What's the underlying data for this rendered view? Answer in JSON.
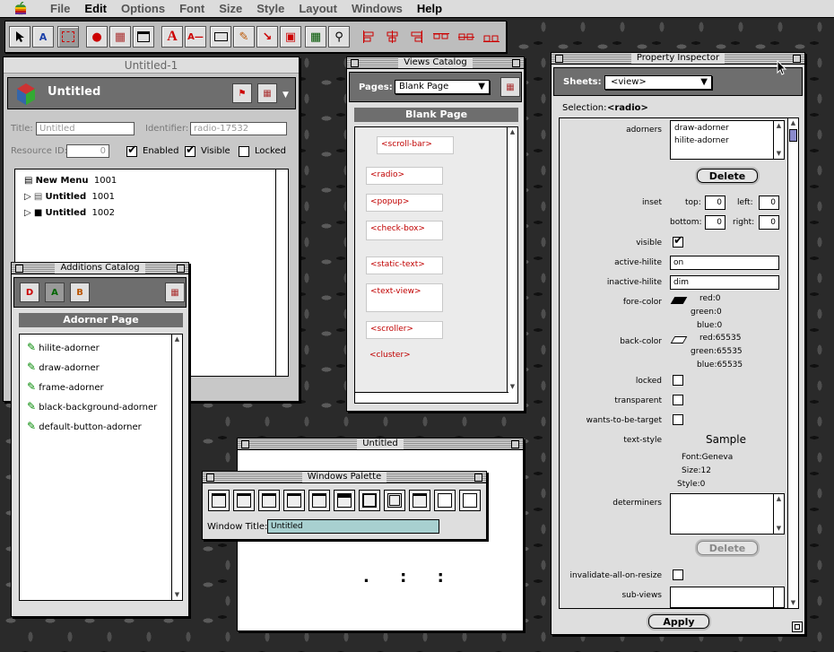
{
  "menubar": {
    "items": [
      "File",
      "Edit",
      "Options",
      "Font",
      "Size",
      "Style",
      "Layout",
      "Windows",
      "Help"
    ],
    "active": [
      "Edit",
      "Help"
    ]
  },
  "toolbar": {
    "tools": [
      "arrow-tool",
      "text-arrow-tool",
      "marquee-tool",
      "adorner-tool",
      "stack-tool",
      "window-tool",
      "text-tool",
      "static-text-tool",
      "edit-text-tool",
      "property-tool",
      "link-tool",
      "cluster-tool",
      "grid-tool",
      "zoom-tool",
      "align-left-tool",
      "align-center-tool",
      "align-right-tool",
      "distribute-h-tool",
      "distribute-v-tool",
      "distribute-bottom-tool"
    ],
    "tool_glyphs": {
      "text-tool": "A"
    }
  },
  "untitled1": {
    "title": "Untitled-1",
    "header": "Untitled",
    "title_label": "Title:",
    "title_value": "Untitled",
    "identifier_label": "Identifier:",
    "identifier_value": "radio-17532",
    "resource_label": "Resource ID:",
    "resource_value": "0",
    "enabled": "Enabled",
    "visible": "Visible",
    "locked": "Locked",
    "tree": [
      {
        "name": "New Menu",
        "id": "1001"
      },
      {
        "name": "Untitled",
        "id": "1001"
      },
      {
        "name": "Untitled",
        "id": "1002"
      }
    ]
  },
  "views_catalog": {
    "title": "Views Catalog",
    "pages_label": "Pages:",
    "pages_value": "Blank Page",
    "page_header": "Blank Page",
    "items": [
      "<scroll-bar>",
      "<radio>",
      "<popup>",
      "<check-box>",
      "<static-text>",
      "<text-view>",
      "<scroller>",
      "<cluster>"
    ]
  },
  "additions": {
    "title": "Additions Catalog",
    "page_header": "Adorner Page",
    "items": [
      "hilite-adorner",
      "draw-adorner",
      "frame-adorner",
      "black-background-adorner",
      "default-button-adorner"
    ]
  },
  "untitled_win": {
    "title": "Untitled",
    "dots": ". : :"
  },
  "windows_palette": {
    "title": "Windows Palette",
    "window_title_label": "Window Title:",
    "window_title_value": "Untitled"
  },
  "inspector": {
    "title": "Property Inspector",
    "sheets_label": "Sheets:",
    "sheets_value": "<view>",
    "selection_label": "Selection:",
    "selection_value": "<radio>",
    "adorners_label": "adorners",
    "adorners": [
      "draw-adorner",
      "hilite-adorner"
    ],
    "delete": "Delete",
    "inset_label": "inset",
    "top": "top:",
    "left": "left:",
    "bottom": "bottom:",
    "right": "right:",
    "inset_top": "0",
    "inset_left": "0",
    "inset_bottom": "0",
    "inset_right": "0",
    "visible_label": "visible",
    "active_hilite_label": "active-hilite",
    "active_hilite": "on",
    "inactive_hilite_label": "inactive-hilite",
    "inactive_hilite": "dim",
    "fore_color_label": "fore-color",
    "fore": {
      "red": "red:0",
      "green": "green:0",
      "blue": "blue:0"
    },
    "back_color_label": "back-color",
    "back": {
      "red": "red:65535",
      "green": "green:65535",
      "blue": "blue:65535"
    },
    "locked_label": "locked",
    "transparent_label": "transparent",
    "wants_label": "wants-to-be-target",
    "text_style_label": "text-style",
    "sample": "Sample",
    "font": "Font:Geneva",
    "size": "Size:12",
    "style": "Style:0",
    "determiners_label": "determiners",
    "delete2": "Delete",
    "invalidate_label": "invalidate-all-on-resize",
    "subviews_label": "sub-views",
    "apply": "Apply"
  },
  "colors": {
    "label_red": "#c00000",
    "palette_field": "#a8d0d0",
    "header_gray": "#6e6e6e"
  }
}
